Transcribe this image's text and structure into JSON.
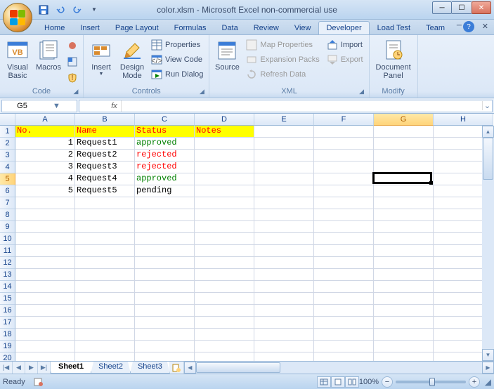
{
  "window": {
    "title": "color.xlsm - Microsoft Excel non-commercial use"
  },
  "ribbon_tabs": [
    "Home",
    "Insert",
    "Page Layout",
    "Formulas",
    "Data",
    "Review",
    "View",
    "Developer",
    "Load Test",
    "Team"
  ],
  "active_tab": 7,
  "ribbon": {
    "code": {
      "label": "Code",
      "visual_basic": "Visual Basic",
      "macros": "Macros"
    },
    "controls": {
      "label": "Controls",
      "insert": "Insert",
      "design_mode": "Design Mode",
      "properties": "Properties",
      "view_code": "View Code",
      "run_dialog": "Run Dialog"
    },
    "xml": {
      "label": "XML",
      "source": "Source",
      "map_properties": "Map Properties",
      "expansion_packs": "Expansion Packs",
      "refresh_data": "Refresh Data",
      "import": "Import",
      "export": "Export"
    },
    "modify": {
      "label": "Modify",
      "document_panel": "Document Panel"
    }
  },
  "name_box": "G5",
  "formula_value": "",
  "columns": [
    "A",
    "B",
    "C",
    "D",
    "E",
    "F",
    "G",
    "H"
  ],
  "active_cell": {
    "col": 6,
    "row": 5
  },
  "max_row": 20,
  "header_row": {
    "A": "No.",
    "B": "Name",
    "C": "Status",
    "D": "Notes"
  },
  "chart_data": {
    "type": "table",
    "columns": [
      "No.",
      "Name",
      "Status",
      "Notes"
    ],
    "rows": [
      {
        "No.": 1,
        "Name": "Request1",
        "Status": "approved",
        "Notes": ""
      },
      {
        "No.": 2,
        "Name": "Request2",
        "Status": "rejected",
        "Notes": ""
      },
      {
        "No.": 3,
        "Name": "Request3",
        "Status": "rejected",
        "Notes": ""
      },
      {
        "No.": 4,
        "Name": "Request4",
        "Status": "approved",
        "Notes": ""
      },
      {
        "No.": 5,
        "Name": "Request5",
        "Status": "pending",
        "Notes": ""
      }
    ]
  },
  "sheets": [
    "Sheet1",
    "Sheet2",
    "Sheet3"
  ],
  "active_sheet": 0,
  "status": {
    "mode": "Ready",
    "zoom": "100%"
  }
}
